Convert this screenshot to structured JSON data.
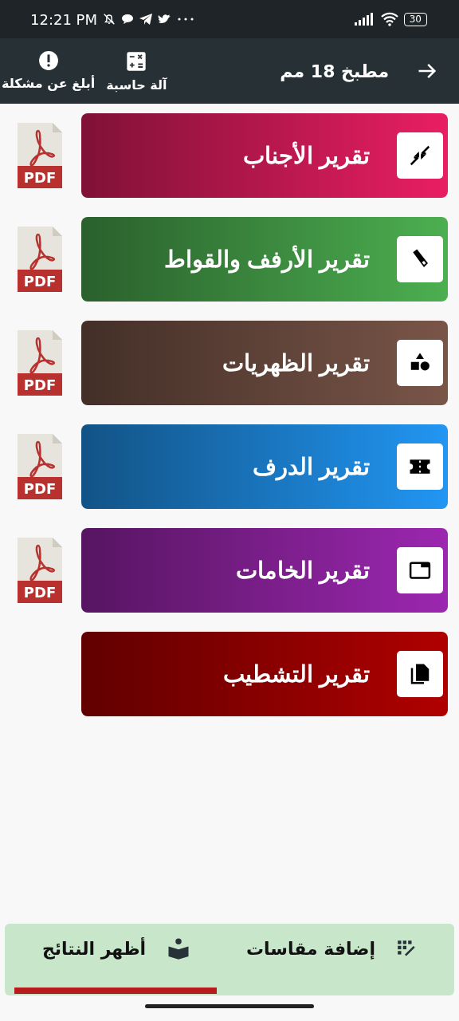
{
  "status_bar": {
    "time": "12:21 PM",
    "battery": "30"
  },
  "toolbar": {
    "title": "مطبخ 18 مم",
    "actions": [
      {
        "label": "آلة حاسبة"
      },
      {
        "label": "أبلغ عن مشكلة"
      }
    ]
  },
  "reports": [
    {
      "title": "تقرير الأجناب",
      "color": "#e91e63",
      "pdf": "PDF"
    },
    {
      "title": "تقرير الأرفف والقواط",
      "color": "#4caf50",
      "pdf": "PDF"
    },
    {
      "title": "تقرير الظهريات",
      "color": "#795548",
      "pdf": "PDF"
    },
    {
      "title": "تقرير   الدرف",
      "color": "#2196f3",
      "pdf": "PDF"
    },
    {
      "title": "تقرير الخامات",
      "color": "#9c27b0",
      "pdf": "PDF"
    },
    {
      "title": "تقرير التشطيب",
      "color": "#b00000"
    }
  ],
  "bottom_bar": {
    "buttons": [
      {
        "label": "إضافة مقاسات"
      },
      {
        "label": "أظهر النتائج"
      }
    ]
  }
}
